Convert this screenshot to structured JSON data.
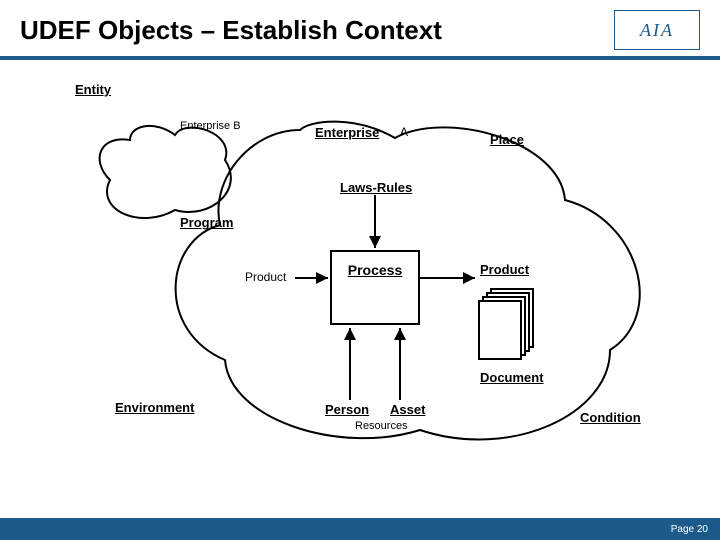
{
  "header": {
    "title": "UDEF Objects – Establish Context",
    "logo_text": "AIA"
  },
  "diagram": {
    "entity": "Entity",
    "enterprise_b": "Enterprise B",
    "enterprise": "Enterprise",
    "a": "A",
    "place": "Place",
    "laws_rules": "Laws-Rules",
    "program": "Program",
    "product_left": "Product",
    "process": "Process",
    "product_right": "Product",
    "document": "Document",
    "environment": "Environment",
    "person": "Person",
    "asset": "Asset",
    "resources": "Resources",
    "condition": "Condition"
  },
  "footer": {
    "page": "Page 20"
  }
}
